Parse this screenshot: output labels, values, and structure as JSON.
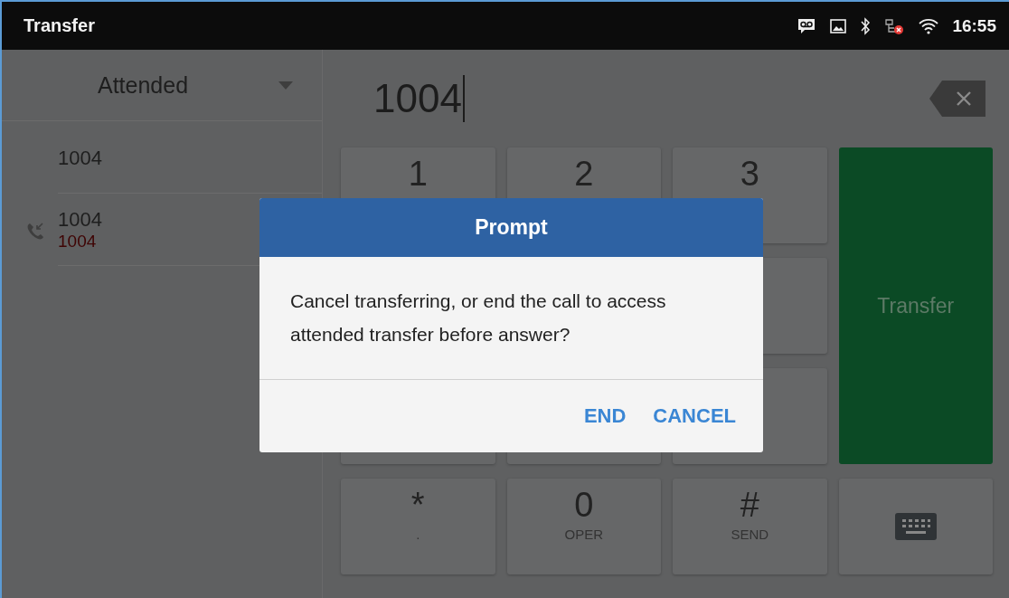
{
  "status_bar": {
    "title": "Transfer",
    "time": "16:55"
  },
  "transfer_mode": {
    "value": "Attended"
  },
  "contacts": [
    {
      "kind": "entry",
      "name": "1004"
    },
    {
      "kind": "call",
      "name": "1004",
      "number": "1004"
    }
  ],
  "dial": {
    "value": "1004"
  },
  "keys": [
    {
      "kind": "digit",
      "digit": "1"
    },
    {
      "kind": "digit",
      "digit": "2"
    },
    {
      "kind": "digit",
      "digit": "3"
    },
    {
      "kind": "blank"
    },
    {
      "kind": "blank"
    },
    {
      "kind": "blank"
    },
    {
      "kind": "blank"
    },
    {
      "kind": "blank"
    },
    {
      "kind": "blank"
    },
    {
      "kind": "digit",
      "digit": "*",
      "letters": "."
    },
    {
      "kind": "digit",
      "digit": "0",
      "letters": "OPER"
    },
    {
      "kind": "digit",
      "digit": "#",
      "letters": "SEND"
    },
    {
      "kind": "keyboard"
    }
  ],
  "transfer_button": {
    "label": "Transfer"
  },
  "dialog": {
    "title": "Prompt",
    "message": "Cancel transferring, or end the call to access attended transfer before answer?",
    "buttons": [
      "END",
      "CANCEL"
    ]
  }
}
